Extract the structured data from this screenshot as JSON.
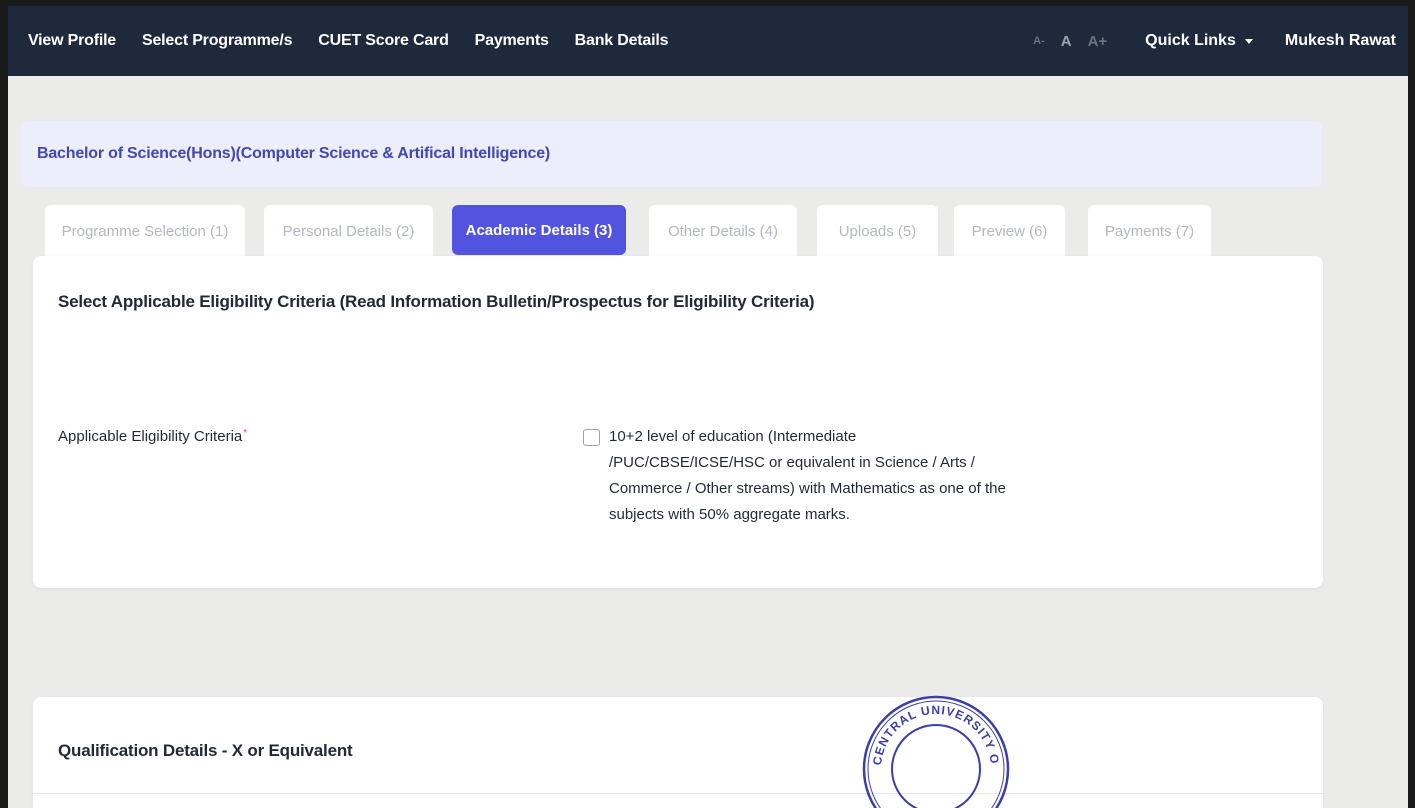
{
  "navbar": {
    "links": [
      "View Profile",
      "Select Programme/s",
      "CUET Score Card",
      "Payments",
      "Bank Details"
    ],
    "font_decrease": "A-",
    "font_normal": "A",
    "font_increase": "A+",
    "quick_links": "Quick Links",
    "user_name": "Mukesh Rawat"
  },
  "programme": {
    "title": "Bachelor of Science(Hons)(Computer Science & Artifical Intelligence)"
  },
  "tabs": [
    {
      "label": "Programme Selection  (1)",
      "active": false
    },
    {
      "label": "Personal Details  (2)",
      "active": false
    },
    {
      "label": "Academic Details  (3)",
      "active": true
    },
    {
      "label": "Other Details  (4)",
      "active": false
    },
    {
      "label": "Uploads  (5)",
      "active": false
    },
    {
      "label": "Preview  (6)",
      "active": false
    },
    {
      "label": "Payments  (7)",
      "active": false
    }
  ],
  "eligibility": {
    "title": "Select Applicable Eligibility Criteria (Read Information Bulletin/Prospectus for Eligibility Criteria)",
    "field_label": "Applicable Eligibility Criteria",
    "required_marker": "*",
    "criteria_option": "10+2 level of education (Intermediate /PUC/CBSE/ICSE/HSC or equivalent in Science / Arts / Commerce / Other streams) with Mathematics as one of the subjects with 50% aggregate marks.",
    "checked": false
  },
  "qualification": {
    "title": "Qualification Details - X or Equivalent"
  },
  "seal": {
    "text": "CENTRAL UNIVERSITY OF ANDHRA PRADESH"
  },
  "colors": {
    "navbar_bg": "#1e293b",
    "accent": "#5254e0",
    "banner_bg": "#eceefb",
    "banner_text": "#4446b4",
    "page_bg": "#ebebea",
    "seal_ink": "#3b3fa8"
  }
}
